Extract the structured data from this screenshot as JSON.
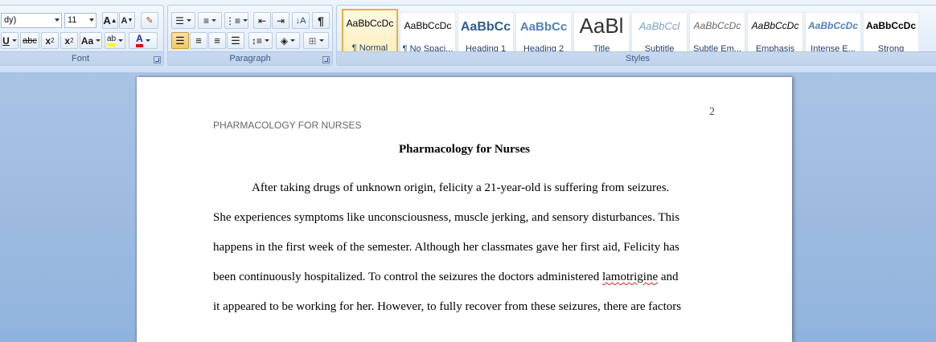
{
  "ribbon": {
    "font_group": {
      "label": "Font",
      "font_name": "dy)",
      "font_size": "11",
      "grow_label": "A",
      "shrink_label": "A",
      "clear_label": "",
      "underline_label": "U",
      "strike_label": "abc",
      "subscript_label": "x",
      "superscript_label": "x",
      "change_case_label": "Aa",
      "highlight_label": "ab",
      "font_color_label": "A"
    },
    "paragraph_group": {
      "label": "Paragraph",
      "show_marks_label": "¶"
    },
    "styles_group": {
      "label": "Styles",
      "styles": [
        {
          "sample": "AaBbCcDc",
          "name": "¶ Normal",
          "color": "#000000",
          "italic": false,
          "bold": false,
          "size": 12
        },
        {
          "sample": "AaBbCcDc",
          "name": "¶ No Spaci...",
          "color": "#000000",
          "italic": false,
          "bold": false,
          "size": 12
        },
        {
          "sample": "AaBbCc",
          "name": "Heading 1",
          "color": "#2f5c8f",
          "italic": false,
          "bold": true,
          "size": 16
        },
        {
          "sample": "AaBbCc",
          "name": "Heading 2",
          "color": "#4f81bd",
          "italic": false,
          "bold": true,
          "size": 15
        },
        {
          "sample": "AaBl",
          "name": "Title",
          "color": "#333333",
          "italic": false,
          "bold": false,
          "size": 26
        },
        {
          "sample": "AaBbCcl",
          "name": "Subtitle",
          "color": "#7f9fc6",
          "italic": true,
          "bold": false,
          "size": 13
        },
        {
          "sample": "AaBbCcDc",
          "name": "Subtle Em...",
          "color": "#666666",
          "italic": true,
          "bold": false,
          "size": 12
        },
        {
          "sample": "AaBbCcDc",
          "name": "Emphasis",
          "color": "#000000",
          "italic": true,
          "bold": false,
          "size": 12
        },
        {
          "sample": "AaBbCcDc",
          "name": "Intense E...",
          "color": "#4f81bd",
          "italic": true,
          "bold": true,
          "size": 12
        },
        {
          "sample": "AaBbCcDc",
          "name": "Strong",
          "color": "#000000",
          "italic": false,
          "bold": true,
          "size": 12
        }
      ]
    }
  },
  "document": {
    "page_number": "2",
    "running_head": "PHARMACOLOGY FOR NURSES",
    "title": "Pharmacology for Nurses",
    "lines": [
      {
        "text": "After taking drugs of unknown origin,  felicity a 21-year-old is suffering from seizures.",
        "indent": true
      },
      {
        "text": "She experiences  symptoms like unconsciousness,  muscle jerking,  and sensory disturbances. This",
        "indent": false
      },
      {
        "text": "happens in  the first week of the semester.  Although her classmates  gave her first aid, Felicity has",
        "indent": false
      },
      {
        "before": "been continuously hospitalized. To  control the seizures  the doctors administered ",
        "misspelled": "lamotrigine",
        "after": "  and",
        "indent": false
      },
      {
        "text": "it appeared to be working  for her.  However, to fully recover from these seizures,  there are factors",
        "indent": false
      }
    ]
  }
}
